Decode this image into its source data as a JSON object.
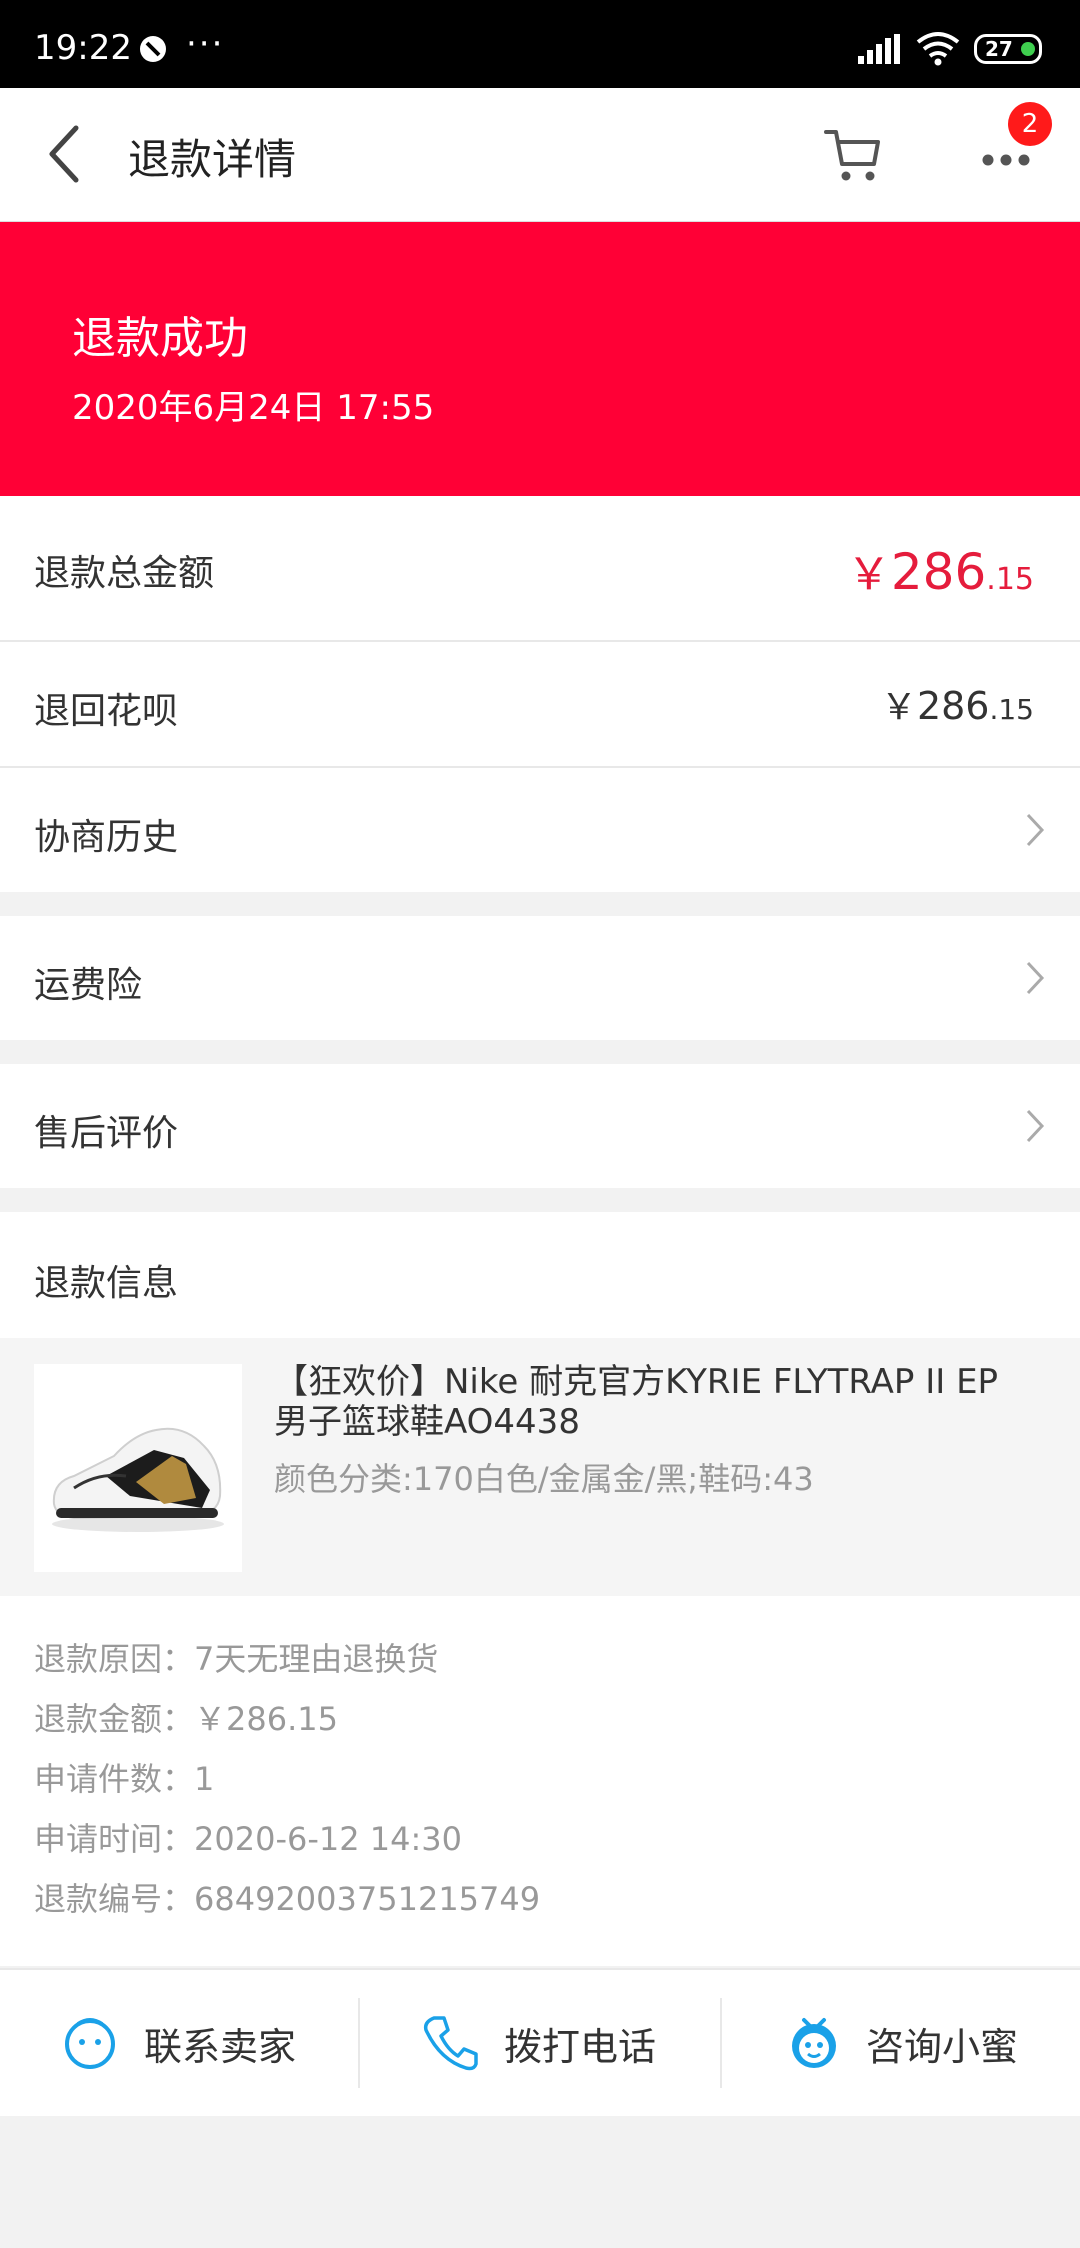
{
  "status_bar": {
    "time": "19:22",
    "dots": "···",
    "battery": "27"
  },
  "navbar": {
    "title": "退款详情",
    "badge": "2"
  },
  "banner": {
    "status": "退款成功",
    "date": "2020年6月24日 17:55"
  },
  "refund_total": {
    "label": "退款总金额",
    "currency": "￥",
    "integer": "286",
    "decimal": ".15"
  },
  "huabei": {
    "label": "退回花呗",
    "currency": "￥",
    "integer": "286",
    "decimal": ".15"
  },
  "rows": {
    "negotiation": "协商历史",
    "shipping_insurance": "运费险",
    "after_sale_review": "售后评价",
    "refund_info": "退款信息"
  },
  "product": {
    "title": "【狂欢价】Nike 耐克官方KYRIE FLYTRAP II EP 男子篮球鞋AO4438",
    "spec": "颜色分类:170白色/金属金/黑;鞋码:43"
  },
  "info": {
    "reason": "退款原因：7天无理由退换货",
    "amount": "退款金额：￥286.15",
    "count": "申请件数：1",
    "time": "申请时间：2020-6-12 14:30",
    "number": "退款编号：68492003751215749"
  },
  "actions": [
    {
      "label": "联系卖家",
      "icon": "chat-face-icon"
    },
    {
      "label": "拨打电话",
      "icon": "phone-icon"
    },
    {
      "label": "咨询小蜜",
      "icon": "assistant-icon"
    }
  ],
  "colors": {
    "accent": "#ff0036",
    "price": "#e51c3c",
    "badge": "#ff1a1a",
    "icon_blue": "#1aa1e8"
  }
}
